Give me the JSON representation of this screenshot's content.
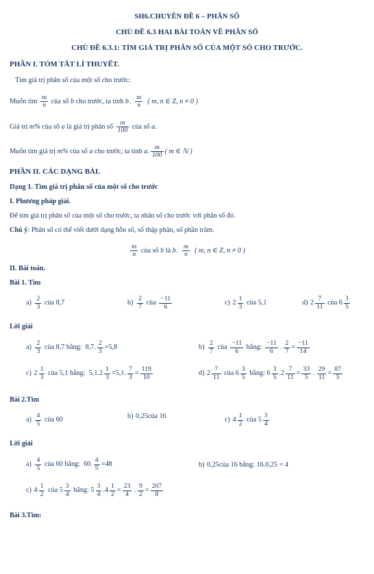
{
  "document": {
    "titles": [
      "SH6.CHUYÊN ĐỀ 6 – PHÂN SỐ",
      "CHỦ ĐỀ 6.3 HAI BÀI TOÁN VỀ PHÂN SỐ",
      "CHỦ ĐỀ 6.3.1: TÌM GIÁ TRỊ PHÂN SỐ CỦA MỘT SỐ CHO TRƯỚC."
    ],
    "text_color": "#1F3864",
    "background_color": "#FFFFFF"
  },
  "part1": {
    "heading": "PHẦN I. TÓM TẮT LÍ THUYẾT.",
    "intro": "Tìm giá trị phân số của một số cho trước:",
    "rule1": {
      "lead": "Muốn tìm",
      "frac_num": "m",
      "frac_den": "n",
      "mid": "của số",
      "var_b": "b",
      "after": "cho trước, ta tính",
      "b2": "b",
      "dot": ".",
      "frac2_num": "m",
      "frac2_den": "n",
      "condition": "( m, n ∈ Z, n ≠ 0 )"
    },
    "rule2": {
      "lead": "Giá trị",
      "m_percent": "m%",
      "mid1": "của số",
      "var_a": "a",
      "mid2": "là giá trị phân số",
      "frac_num": "m",
      "frac_den": "100",
      "mid3": "của số",
      "var_a2": "a",
      "period": "."
    },
    "rule3": {
      "lead": "Muốn tìm giá trị",
      "m_percent": "m%",
      "mid1": "của số",
      "var_a": "a",
      "mid2": "cho trước, ta tính",
      "var_a2": "a.",
      "frac_num": "m",
      "frac_den": "100",
      "condition": "( m ∈ ℕ )"
    }
  },
  "part2": {
    "heading": "PHẦN II. CÁC DẠNG BÀI.",
    "dang1": "Dạng 1. Tìm giá trị phân số của một số cho trước",
    "method_heading": "I. Phương pháp giải.",
    "method_text": "Để tìm giá trị phân số của một số cho trước, ta nhân số cho trước với phân số đó.",
    "note_label": "Chú ý",
    "note_text": ": Phân số có thể viết dưới dạng hỗn số, số thập phân, số phần trăm.",
    "center_formula": {
      "frac_num": "m",
      "frac_den": "n",
      "mid": "của số",
      "var_b": "b",
      "la": "là",
      "b2": "b",
      "dot": ".",
      "frac2_num": "m",
      "frac2_den": "n",
      "condition": "( m, n ∈ Z, n ≠ 0 )"
    },
    "exercises_heading": "II. Bài toán."
  },
  "bai1": {
    "heading": "Bài 1. Tìm",
    "solution_heading": "Lời giải",
    "items": [
      {
        "label": "a)",
        "num": "2",
        "den": "3",
        "cua": "của",
        "value": "8,7"
      },
      {
        "label": "b)",
        "num": "2",
        "den": "7",
        "cua": "của",
        "value_num": "−11",
        "value_den": "6"
      },
      {
        "label": "c)",
        "whole": "2",
        "num": "1",
        "den": "3",
        "cua": "của",
        "value": "5,1"
      },
      {
        "label": "d)",
        "whole": "2",
        "num": "7",
        "den": "11",
        "cua": "của",
        "value_whole": "6",
        "value_num": "3",
        "value_den": "5"
      }
    ],
    "solutions": {
      "a": {
        "label": "a)",
        "num": "2",
        "den": "3",
        "cua": "của",
        "value": "8,7",
        "bang": "bằng:",
        "expr_lead": "8,7.",
        "e_num": "2",
        "e_den": "3",
        "eq": "=",
        "result": "5,8"
      },
      "b": {
        "label": "b)",
        "num": "2",
        "den": "7",
        "cua": "của",
        "v_num": "−11",
        "v_den": "6",
        "bang": "bằng:",
        "r1_num": "−11",
        "r1_den": "6",
        "dot": ".",
        "r2_num": "2",
        "r2_den": "7",
        "eq": "=",
        "res_num": "−11",
        "res_den": "14"
      },
      "c": {
        "label": "c)",
        "whole": "2",
        "num": "1",
        "den": "3",
        "cua": "của",
        "value": "5,1",
        "bang": "bằng:",
        "lead": "5,1.2",
        "m_num": "1",
        "m_den": "3",
        "eq1": "=",
        "mid": "5,1.",
        "s_num": "7",
        "s_den": "3",
        "eq2": "=",
        "res_num": "119",
        "res_den": "10"
      },
      "d": {
        "label": "d)",
        "whole": "2",
        "num": "7",
        "den": "11",
        "cua": "của",
        "v_whole": "6",
        "v_num": "3",
        "v_den": "5",
        "bang": "bằng:",
        "l_whole": "6",
        "l_num": "3",
        "l_den": "5",
        "dot1": ".2",
        "m_num": "7",
        "m_den": "11",
        "eq1": "=",
        "a_num": "33",
        "a_den": "5",
        "dot2": ".",
        "b_num": "29",
        "b_den": "11",
        "eq2": "=",
        "res_num": "87",
        "res_den": "5"
      }
    }
  },
  "bai2": {
    "heading": "Bài 2.Tìm",
    "solution_heading": "Lời giải",
    "items": [
      {
        "label": "a)",
        "num": "4",
        "den": "5",
        "cua": "của",
        "value": "60"
      },
      {
        "label": "b)",
        "decimal": "0,25",
        "cua": "của",
        "value": "16"
      },
      {
        "label": "c)",
        "whole": "4",
        "num": "1",
        "den": "2",
        "cua": "của",
        "value_whole": "5",
        "value_num": "3",
        "value_den": "4"
      }
    ],
    "solutions": {
      "a": {
        "label": "a)",
        "num": "4",
        "den": "5",
        "cua": "của",
        "value": "60",
        "bang": "bằng:",
        "lead": "60.",
        "e_num": "4",
        "e_den": "5",
        "eq": "=",
        "result": "48"
      },
      "b": {
        "label": "b)",
        "decimal": "0,25",
        "cua": "của",
        "value": "16",
        "bang": "bằng:",
        "expr": "16.0,25 = 4"
      },
      "c": {
        "label": "c)",
        "whole": "4",
        "num": "1",
        "den": "2",
        "cua": "của",
        "v_whole": "5",
        "v_num": "3",
        "v_den": "4",
        "bang": "bằng:",
        "l_whole": "5",
        "l_num": "3",
        "l_den": "4",
        "dot1": ".4",
        "m_num": "1",
        "m_den": "2",
        "eq1": "=",
        "a_num": "23",
        "a_den": "4",
        "dot2": ".",
        "b_num": "9",
        "b_den": "2",
        "eq2": "=",
        "res_num": "207",
        "res_den": "8"
      }
    }
  },
  "bai3": {
    "heading": "Bài 3.Tìm:"
  }
}
